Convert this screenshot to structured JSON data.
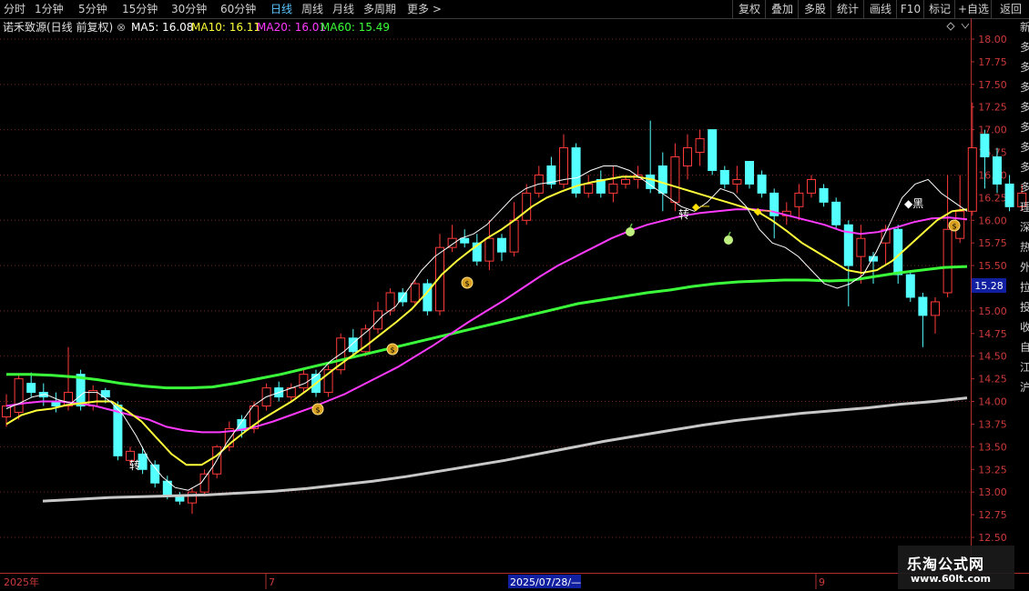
{
  "toolbar": {
    "tabs": [
      "分时",
      "1分钟",
      "5分钟",
      "15分钟",
      "30分钟",
      "60分钟",
      "日线",
      "周线",
      "月线",
      "多周期",
      "更多 >"
    ],
    "active_tab": "日线",
    "right_buttons": [
      "复权",
      "叠加",
      "多股",
      "统计",
      "画线",
      "F10",
      "标记",
      "+自选",
      "返回"
    ]
  },
  "legend": {
    "title": "诺禾致源(日线 前复权)",
    "ma5": "MA5: 16.08",
    "ma10": "MA10: 16.11",
    "ma20": "MA20: 16.01",
    "ma60": "MA60: 15.49"
  },
  "price_axis": {
    "ticks": [
      "18.00",
      "17.75",
      "17.50",
      "17.25",
      "17.00",
      "16.75",
      "16.50",
      "16.25",
      "16.00",
      "15.75",
      "15.50",
      "15.25",
      "15.00",
      "14.75",
      "14.50",
      "14.25",
      "14.00",
      "13.75",
      "13.50",
      "13.25",
      "13.00",
      "12.75",
      "12.50"
    ],
    "current_price": "15.28"
  },
  "date_axis": {
    "year_label": "2025年",
    "month_jul": "7",
    "cursor_date": "2025/07/28/—",
    "month_sep": "9"
  },
  "side_strip_text": [
    "新",
    "多",
    "多",
    "多",
    "多",
    "多",
    "多",
    "多",
    "多",
    "理",
    "深",
    "热",
    "外",
    "拉",
    "投",
    "收",
    "自",
    "江",
    "沪"
  ],
  "signals": {
    "zhuan": "转",
    "bei": "◆黑",
    "yi": "◆一",
    "yi2": "◆一"
  },
  "watermark": {
    "name": "乐淘公式网",
    "url": "www.60lt.com"
  },
  "colors": {
    "up": "#ff3a3a",
    "down": "#54ffff",
    "ma5": "#ffffff",
    "ma10": "#ffff3a",
    "ma20": "#ff3aff",
    "ma60": "#3aff3a",
    "ma250": "#c8c8c8"
  },
  "chart_data": {
    "type": "candlestick",
    "candles": [
      [
        13.83,
        13.95,
        13.72,
        14.08
      ],
      [
        13.88,
        14.25,
        13.8,
        14.3
      ],
      [
        14.2,
        14.1,
        14.05,
        14.32
      ],
      [
        14.1,
        14.05,
        13.95,
        14.2
      ],
      [
        14.0,
        13.95,
        13.88,
        14.1
      ],
      [
        13.95,
        14.1,
        13.9,
        14.6
      ],
      [
        14.3,
        13.95,
        13.9,
        14.35
      ],
      [
        13.95,
        14.12,
        13.9,
        14.18
      ],
      [
        14.12,
        14.05,
        13.98,
        14.15
      ],
      [
        13.96,
        13.4,
        13.35,
        14.0
      ],
      [
        13.35,
        13.45,
        13.3,
        13.5
      ],
      [
        13.42,
        13.25,
        13.2,
        13.5
      ],
      [
        13.3,
        13.1,
        13.05,
        13.35
      ],
      [
        13.12,
        12.96,
        12.92,
        13.18
      ],
      [
        12.96,
        12.9,
        12.86,
        13.0
      ],
      [
        12.88,
        13.0,
        12.76,
        13.05
      ],
      [
        13.0,
        13.2,
        12.95,
        13.25
      ],
      [
        13.2,
        13.5,
        13.15,
        13.52
      ],
      [
        13.5,
        13.7,
        13.45,
        13.78
      ],
      [
        13.8,
        13.68,
        13.6,
        13.85
      ],
      [
        13.7,
        13.95,
        13.65,
        14.0
      ],
      [
        13.95,
        14.15,
        13.9,
        14.2
      ],
      [
        14.15,
        14.05,
        14.0,
        14.22
      ],
      [
        14.05,
        14.15,
        14.0,
        14.2
      ],
      [
        14.15,
        14.3,
        14.1,
        14.35
      ],
      [
        14.3,
        14.1,
        14.05,
        14.35
      ],
      [
        14.1,
        14.35,
        14.05,
        14.4
      ],
      [
        14.35,
        14.7,
        14.3,
        14.75
      ],
      [
        14.7,
        14.55,
        14.5,
        14.8
      ],
      [
        14.55,
        14.8,
        14.5,
        14.85
      ],
      [
        14.8,
        15.0,
        14.75,
        15.1
      ],
      [
        15.0,
        15.2,
        14.95,
        15.25
      ],
      [
        15.2,
        15.1,
        15.05,
        15.25
      ],
      [
        15.1,
        15.3,
        15.05,
        15.35
      ],
      [
        15.3,
        15.0,
        14.95,
        15.35
      ],
      [
        15.0,
        15.7,
        14.95,
        15.85
      ],
      [
        15.7,
        15.8,
        15.65,
        15.95
      ],
      [
        15.8,
        15.75,
        15.7,
        15.9
      ],
      [
        15.75,
        15.55,
        15.5,
        15.85
      ],
      [
        15.55,
        15.8,
        15.45,
        16.0
      ],
      [
        15.8,
        15.65,
        15.55,
        15.85
      ],
      [
        15.65,
        16.0,
        15.6,
        16.2
      ],
      [
        16.0,
        16.3,
        15.95,
        16.4
      ],
      [
        16.3,
        16.5,
        16.25,
        16.6
      ],
      [
        16.6,
        16.4,
        16.35,
        16.7
      ],
      [
        16.4,
        16.8,
        16.35,
        16.95
      ],
      [
        16.8,
        16.3,
        16.25,
        16.85
      ],
      [
        16.3,
        16.4,
        16.25,
        16.5
      ],
      [
        16.45,
        16.3,
        16.25,
        16.55
      ],
      [
        16.3,
        16.4,
        16.2,
        16.6
      ],
      [
        16.4,
        16.45,
        16.35,
        16.5
      ],
      [
        16.45,
        16.5,
        16.35,
        16.6
      ],
      [
        16.5,
        16.35,
        16.3,
        17.1
      ],
      [
        16.6,
        16.3,
        16.1,
        16.75
      ],
      [
        16.2,
        16.7,
        16.1,
        16.85
      ],
      [
        16.6,
        16.8,
        16.45,
        16.95
      ],
      [
        16.75,
        16.9,
        16.6,
        17.0
      ],
      [
        17.0,
        16.55,
        16.5,
        17.0
      ],
      [
        16.55,
        16.4,
        16.35,
        16.6
      ],
      [
        16.4,
        16.45,
        16.3,
        16.6
      ],
      [
        16.65,
        16.4,
        16.35,
        16.65
      ],
      [
        16.5,
        16.3,
        16.25,
        16.55
      ],
      [
        16.3,
        16.05,
        15.8,
        16.35
      ],
      [
        16.05,
        16.1,
        15.95,
        16.2
      ],
      [
        16.15,
        16.3,
        16.0,
        16.4
      ],
      [
        16.3,
        16.45,
        16.25,
        16.5
      ],
      [
        16.35,
        16.2,
        16.15,
        16.4
      ],
      [
        16.2,
        15.95,
        15.9,
        16.25
      ],
      [
        15.95,
        15.5,
        15.05,
        16.0
      ],
      [
        15.6,
        15.8,
        15.3,
        15.95
      ],
      [
        15.6,
        15.55,
        15.3,
        15.65
      ],
      [
        15.75,
        15.9,
        15.5,
        15.95
      ],
      [
        15.9,
        15.4,
        15.3,
        15.95
      ],
      [
        15.4,
        15.15,
        15.1,
        15.45
      ],
      [
        15.15,
        14.95,
        14.6,
        15.2
      ],
      [
        14.95,
        15.1,
        14.75,
        15.15
      ],
      [
        15.2,
        15.9,
        15.15,
        16.5
      ],
      [
        15.8,
        16.1,
        15.75,
        16.5
      ],
      [
        16.1,
        16.8,
        16.05,
        17.3
      ],
      [
        16.95,
        16.7,
        16.35,
        17.0
      ],
      [
        16.7,
        16.4,
        16.3,
        16.8
      ],
      [
        16.4,
        16.15,
        16.1,
        16.5
      ],
      [
        16.15,
        16.3,
        16.1,
        16.4
      ],
      [
        16.15,
        15.85,
        15.75,
        16.2
      ]
    ],
    "ma5": [
      13.92,
      13.98,
      14.05,
      14.08,
      14.02,
      13.98,
      14.1,
      14.1,
      14.0,
      13.85,
      13.62,
      13.35,
      13.17,
      13.05,
      13.02,
      13.1,
      13.3,
      13.55,
      13.75,
      13.95,
      14.05,
      14.1,
      14.15,
      14.2,
      14.3,
      14.45,
      14.55,
      14.68,
      14.8,
      14.95,
      15.05,
      15.25,
      15.45,
      15.6,
      15.7,
      15.8,
      15.85,
      15.95,
      16.1,
      16.25,
      16.35,
      16.4,
      16.42,
      16.45,
      16.47,
      16.55,
      16.6,
      16.6,
      16.55,
      16.45,
      16.35,
      16.25,
      16.15,
      16.1,
      16.2,
      16.35,
      16.3,
      16.15,
      15.9,
      15.75,
      15.7,
      15.6,
      15.45,
      15.3,
      15.25,
      15.3,
      15.4,
      15.65,
      15.95,
      16.25,
      16.4,
      16.45,
      16.3,
      16.2,
      16.1
    ],
    "ma10": [
      13.75,
      13.85,
      13.9,
      13.92,
      13.96,
      13.98,
      14.0,
      14.0,
      13.9,
      13.78,
      13.6,
      13.42,
      13.3,
      13.3,
      13.4,
      13.55,
      13.68,
      13.8,
      13.9,
      14.0,
      14.12,
      14.25,
      14.38,
      14.5,
      14.62,
      14.75,
      14.88,
      15.02,
      15.2,
      15.4,
      15.55,
      15.68,
      15.8,
      15.9,
      16.02,
      16.15,
      16.25,
      16.32,
      16.38,
      16.42,
      16.45,
      16.48,
      16.48,
      16.45,
      16.4,
      16.35,
      16.3,
      16.25,
      16.2,
      16.15,
      16.1,
      16.0,
      15.88,
      15.75,
      15.65,
      15.55,
      15.45,
      15.42,
      15.45,
      15.55,
      15.7,
      15.85,
      16.0,
      16.1,
      16.12
    ],
    "ma20": [
      13.95,
      13.98,
      14.0,
      14.0,
      13.98,
      13.95,
      13.9,
      13.85,
      13.8,
      13.72,
      13.68,
      13.66,
      13.66,
      13.68,
      13.72,
      13.78,
      13.85,
      13.92,
      14.0,
      14.08,
      14.18,
      14.28,
      14.38,
      14.5,
      14.62,
      14.75,
      14.88,
      15.0,
      15.12,
      15.25,
      15.38,
      15.5,
      15.6,
      15.7,
      15.8,
      15.88,
      15.95,
      16.0,
      16.05,
      16.08,
      16.1,
      16.12,
      16.12,
      16.1,
      16.05,
      16.0,
      15.95,
      15.88,
      15.85,
      15.87,
      15.92,
      15.98,
      16.02,
      16.03,
      16.01
    ],
    "ma60": [
      14.3,
      14.3,
      14.29,
      14.27,
      14.24,
      14.2,
      14.17,
      14.15,
      14.15,
      14.16,
      14.2,
      14.25,
      14.3,
      14.36,
      14.42,
      14.48,
      14.54,
      14.6,
      14.66,
      14.72,
      14.78,
      14.84,
      14.9,
      14.96,
      15.02,
      15.08,
      15.12,
      15.16,
      15.2,
      15.23,
      15.27,
      15.3,
      15.32,
      15.33,
      15.34,
      15.34,
      15.33,
      15.34,
      15.38,
      15.42,
      15.45,
      15.48,
      15.49
    ],
    "ma250": [
      12.9,
      12.92,
      12.94,
      12.95,
      12.96,
      12.97,
      12.99,
      13.01,
      13.04,
      13.08,
      13.12,
      13.17,
      13.23,
      13.29,
      13.35,
      13.42,
      13.49,
      13.56,
      13.62,
      13.68,
      13.74,
      13.79,
      13.83,
      13.87,
      13.9,
      13.93,
      13.97,
      14.0,
      14.04
    ],
    "ylim": [
      12.5,
      18.0
    ]
  }
}
